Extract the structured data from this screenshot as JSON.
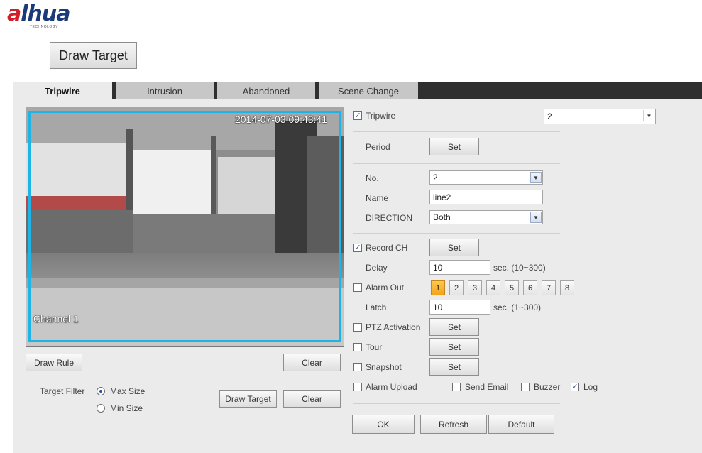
{
  "logo": {
    "brand_mark": "a",
    "brand_rest": "lhua",
    "tagline": "TECHNOLOGY"
  },
  "top": {
    "draw_target_label": "Draw Target"
  },
  "tabs": [
    {
      "label": "Tripwire",
      "active": true
    },
    {
      "label": "Intrusion",
      "active": false
    },
    {
      "label": "Abandoned",
      "active": false
    },
    {
      "label": "Scene Change",
      "active": false
    }
  ],
  "video": {
    "timestamp": "2014-07-03 09:43:41",
    "channel": "Channel 1",
    "frame_color": "#1fb4e8"
  },
  "left_controls": {
    "draw_rule": "Draw Rule",
    "clear": "Clear",
    "target_filter": "Target Filter",
    "max_size": "Max Size",
    "min_size": "Min Size",
    "draw_target": "Draw Target",
    "clear2": "Clear"
  },
  "settings": {
    "tripwire_label": "Tripwire",
    "tripwire_checked": true,
    "tripwire_select": "2",
    "period": "Period",
    "set": "Set",
    "no_label": "No.",
    "no_value": "2",
    "name_label": "Name",
    "name_value": "line2",
    "direction_label": "DIRECTION",
    "direction_value": "Both",
    "record_ch": "Record CH",
    "record_checked": true,
    "delay_label": "Delay",
    "delay_value": "10",
    "delay_range": "sec. (10~300)",
    "alarm_out": "Alarm Out",
    "alarm_channels": [
      "1",
      "2",
      "3",
      "4",
      "5",
      "6",
      "7",
      "8"
    ],
    "latch_label": "Latch",
    "latch_value": "10",
    "latch_range": "sec. (1~300)",
    "ptz": "PTZ Activation",
    "tour": "Tour",
    "snapshot": "Snapshot",
    "alarm_upload": "Alarm Upload",
    "send_email": "Send Email",
    "buzzer": "Buzzer",
    "log": "Log",
    "log_checked": true,
    "check_mark": "✓"
  },
  "footer": {
    "ok": "OK",
    "refresh": "Refresh",
    "default": "Default"
  },
  "colors": {
    "accent": "#1fb4e8",
    "alarm_active": "#f2a31b",
    "tab_bar": "#2f2f2f"
  }
}
